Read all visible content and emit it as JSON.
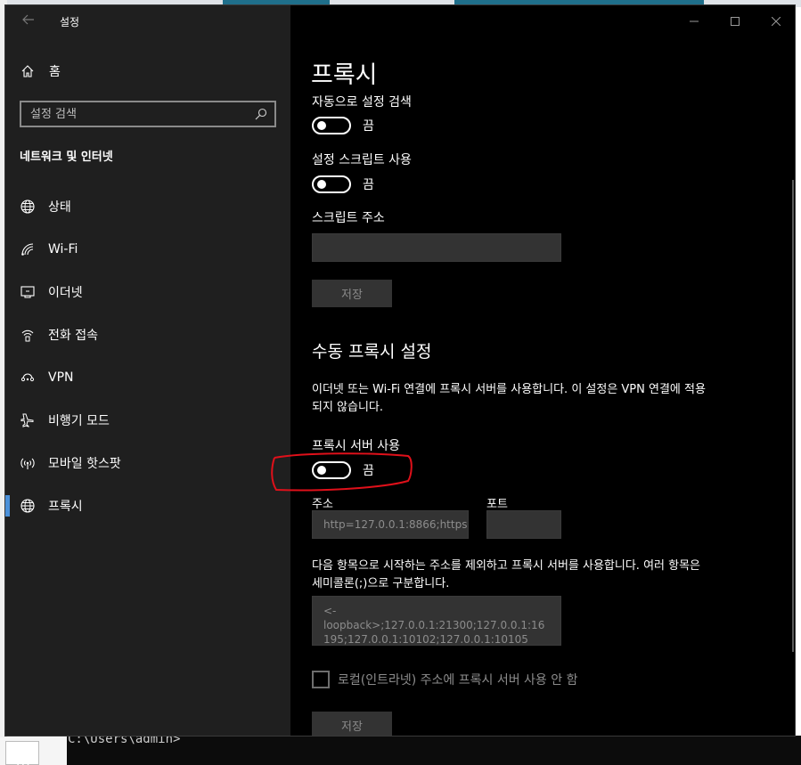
{
  "window": {
    "title": "설정",
    "back_icon": "back-arrow-icon",
    "controls": {
      "minimize": "—",
      "maximize": "☐",
      "close": "✕"
    }
  },
  "sidebar": {
    "home_label": "홈",
    "search_placeholder": "설정 검색",
    "section_title": "네트워크 및 인터넷",
    "items": [
      {
        "label": "상태",
        "icon": "globe-icon"
      },
      {
        "label": "Wi-Fi",
        "icon": "wifi-icon"
      },
      {
        "label": "이더넷",
        "icon": "ethernet-icon"
      },
      {
        "label": "전화 접속",
        "icon": "dialup-icon"
      },
      {
        "label": "VPN",
        "icon": "vpn-icon"
      },
      {
        "label": "비행기 모드",
        "icon": "airplane-icon"
      },
      {
        "label": "모바일 핫스팟",
        "icon": "hotspot-icon"
      },
      {
        "label": "프록시",
        "icon": "globe-icon",
        "active": true
      }
    ]
  },
  "content": {
    "page_title": "프록시",
    "auto_detect_label": "자동으로 설정 검색",
    "auto_detect_state": "끔",
    "script_use_label": "설정 스크립트 사용",
    "script_use_state": "끔",
    "script_address_label": "스크립트 주소",
    "script_address_value": "",
    "save_button_1": "저장",
    "manual_title": "수동 프록시 설정",
    "manual_desc": "이더넷 또는 Wi-Fi 연결에 프록시 서버를 사용합니다. 이 설정은 VPN 연결에 적용되지 않습니다.",
    "use_proxy_label": "프록시 서버 사용",
    "use_proxy_state": "끔",
    "address_label": "주소",
    "address_value": "http=127.0.0.1:8866;https",
    "port_label": "포트",
    "port_value": "",
    "exclude_desc": "다음 항목으로 시작하는 주소를 제외하고 프록시 서버를 사용합니다. 여러 항목은 세미콜론(;)으로 구분합니다.",
    "exclude_value": "<-loopback>;127.0.0.1:21300;127.0.0.1:16195;127.0.0.1:10102;127.0.0.1:10105",
    "local_bypass_label": "로컬(인트라넷) 주소에 프록시 서버 사용 안 함",
    "save_button_2": "저장"
  },
  "background": {
    "console_text": "C:\\Users\\admin>",
    "tile_text": "m"
  },
  "colors": {
    "sidebar_bg": "#1f1f1f",
    "content_bg": "#000000",
    "accent": "#4a90d9",
    "annotation": "#e0101a"
  }
}
